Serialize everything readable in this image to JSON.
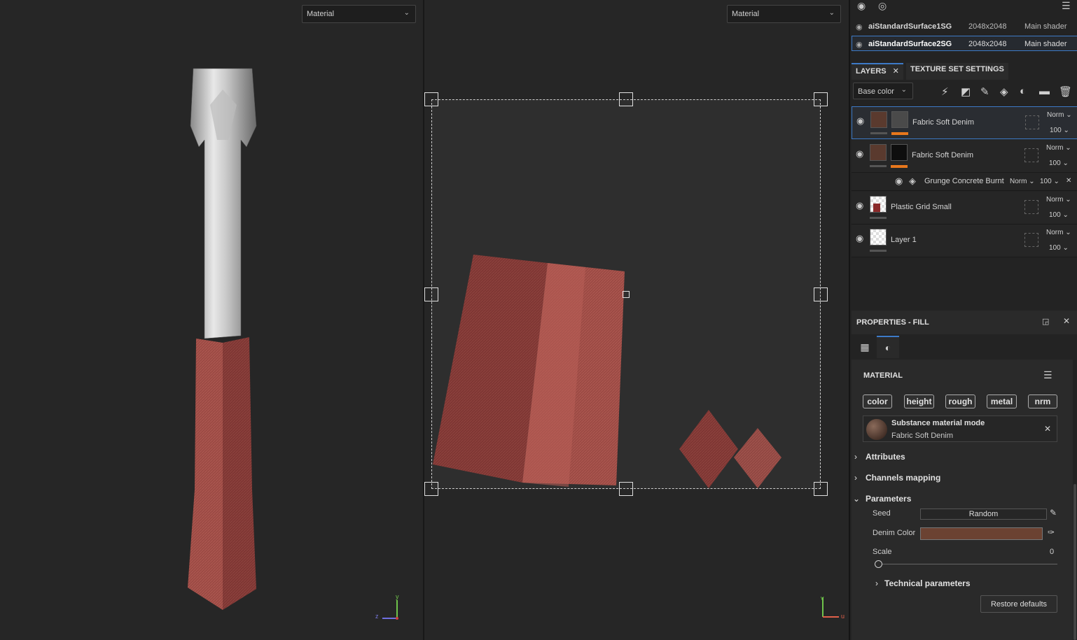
{
  "viewport3d": {
    "dropdown": "Material",
    "axes": {
      "z": "z",
      "y": "y"
    }
  },
  "viewport2d": {
    "dropdown": "Material",
    "axes": {
      "v": "v",
      "u": "u"
    }
  },
  "texture_sets": [
    {
      "name": "aiStandardSurface1SG",
      "size": "2048x2048",
      "shader": "Main shader",
      "selected": false
    },
    {
      "name": "aiStandardSurface2SG",
      "size": "2048x2048",
      "shader": "Main shader",
      "selected": true
    }
  ],
  "tabs": {
    "layers": "LAYERS",
    "texture_set_settings": "TEXTURE SET SETTINGS"
  },
  "channel_select": "Base color",
  "layers": [
    {
      "name": "Fabric Soft Denim",
      "blend": "Norm",
      "opacity": "100",
      "selected": true
    },
    {
      "name": "Fabric Soft Denim",
      "blend": "Norm",
      "opacity": "100",
      "selected": false
    },
    {
      "name": "Plastic Grid Small",
      "blend": "Norm",
      "opacity": "100",
      "selected": false
    },
    {
      "name": "Layer 1",
      "blend": "Norm",
      "opacity": "100",
      "selected": false
    }
  ],
  "sublayer": {
    "name": "Grunge Concrete Burnt",
    "blend": "Norm",
    "opacity": "100"
  },
  "properties": {
    "title": "PROPERTIES - FILL",
    "section": "MATERIAL",
    "channels": [
      "color",
      "height",
      "rough",
      "metal",
      "nrm"
    ],
    "mode_title": "Substance material mode",
    "mode_material": "Fabric Soft Denim",
    "attributes": "Attributes",
    "channels_mapping": "Channels mapping",
    "parameters": "Parameters",
    "seed_label": "Seed",
    "seed_value": "Random",
    "denim_label": "Denim Color",
    "denim_color": "#6b4232",
    "scale_label": "Scale",
    "scale_value": "0",
    "technical": "Technical parameters",
    "restore": "Restore defaults"
  },
  "colors": {
    "accent": "#3d7ac7",
    "orange": "#e8771c"
  }
}
